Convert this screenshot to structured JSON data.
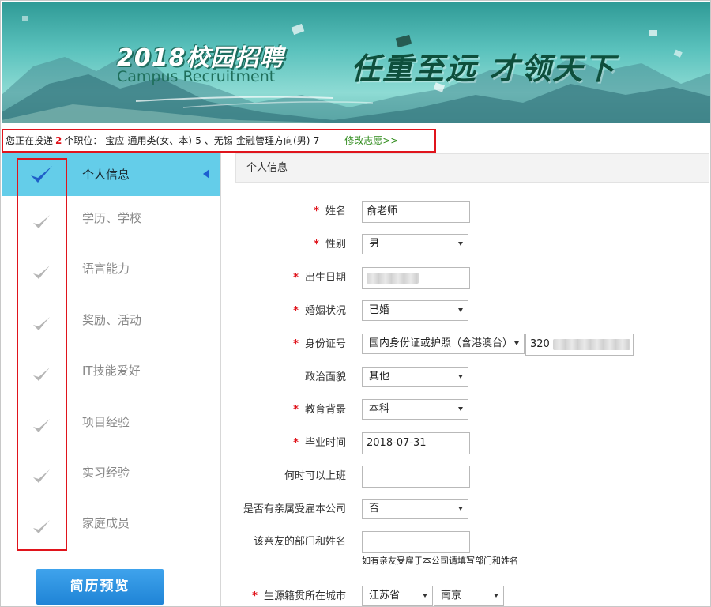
{
  "banner": {
    "year_title": "2018校园招聘",
    "campus_text": "Campus Recruitment",
    "slogan": "任重至远  才领天下"
  },
  "applied": {
    "prefix": "您正在投递",
    "count": "2",
    "suffix": "个职位：",
    "positions": "宝应-通用类(女、本)-5 、无锡-金融管理方向(男)-7",
    "edit_link": "修改志愿>>"
  },
  "sidebar": {
    "items": [
      {
        "label": "个人信息",
        "active": true
      },
      {
        "label": "学历、学校",
        "active": false
      },
      {
        "label": "语言能力",
        "active": false
      },
      {
        "label": "奖励、活动",
        "active": false
      },
      {
        "label": "IT技能爱好",
        "active": false
      },
      {
        "label": "项目经验",
        "active": false
      },
      {
        "label": "实习经验",
        "active": false
      },
      {
        "label": "家庭成员",
        "active": false
      }
    ],
    "preview_button": "简历预览"
  },
  "form": {
    "section_title": "个人信息",
    "name": {
      "label": "姓名",
      "value": "俞老师"
    },
    "gender": {
      "label": "性别",
      "value": "男"
    },
    "birth": {
      "label": "出生日期"
    },
    "marital": {
      "label": "婚姻状况",
      "value": "已婚"
    },
    "idcard": {
      "label": "身份证号",
      "type": "国内身份证或护照（含港澳台）",
      "prefix": "320"
    },
    "political": {
      "label": "政治面貌",
      "value": "其他"
    },
    "education": {
      "label": "教育背景",
      "value": "本科"
    },
    "graduation": {
      "label": "毕业时间",
      "value": "2018-07-31"
    },
    "start_date": {
      "label": "何时可以上班",
      "value": ""
    },
    "relatives": {
      "label": "是否有亲属受雇本公司",
      "value": "否"
    },
    "relative_dept": {
      "label": "该亲友的部门和姓名",
      "value": "",
      "hint": "如有亲友受雇于本公司请填写部门和姓名"
    },
    "origin": {
      "label": "生源籍贯所在城市",
      "province": "江苏省",
      "city": "南京"
    }
  },
  "colors": {
    "active_nav": "#64cde9",
    "required_star": "#e0141c",
    "highlight_border": "#e0141c",
    "preview_button": "#2590e0",
    "edit_link": "#2e8b1a"
  }
}
